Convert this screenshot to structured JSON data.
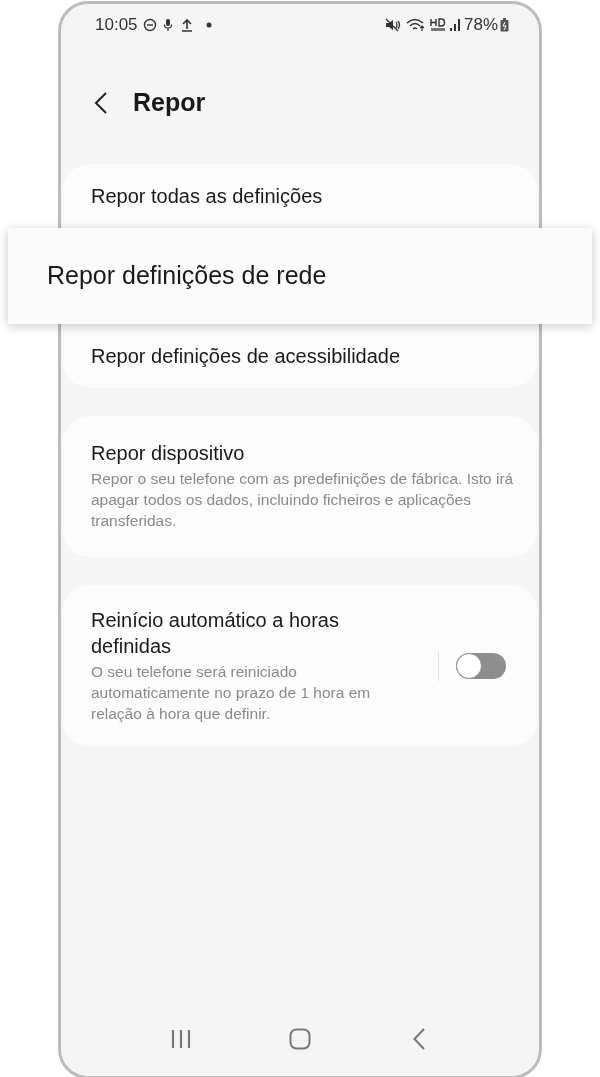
{
  "status_bar": {
    "time": "10:05",
    "battery": "78%"
  },
  "header": {
    "title": "Repor"
  },
  "groups": [
    {
      "items": [
        {
          "kind": "plain",
          "title": "Repor todas as definições"
        },
        {
          "kind": "highlighted",
          "title": "Repor definições de rede"
        },
        {
          "kind": "plain",
          "title": "Repor definições de acessibilidade"
        }
      ]
    },
    {
      "items": [
        {
          "kind": "plain",
          "title": "Repor dispositivo",
          "description": "Repor o seu telefone com as predefinições de fábrica. Isto irá apagar todos os dados, incluindo ficheiros e aplicações transferidas."
        }
      ]
    },
    {
      "items": [
        {
          "kind": "toggle",
          "title": "Reinício automático a horas definidas",
          "description": "O seu telefone será reiniciado automaticamente no prazo de 1 hora em relação à hora que definir.",
          "on": false
        }
      ]
    }
  ]
}
